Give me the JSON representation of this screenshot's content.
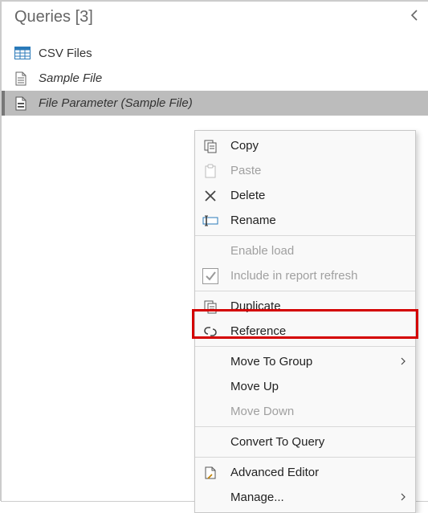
{
  "panel": {
    "title": "Queries [3]"
  },
  "queries": [
    {
      "label": "CSV Files"
    },
    {
      "label": "Sample File"
    },
    {
      "label": "File Parameter (Sample File)"
    }
  ],
  "menu": {
    "copy": "Copy",
    "paste": "Paste",
    "delete": "Delete",
    "rename": "Rename",
    "enable_load": "Enable load",
    "include_refresh": "Include in report refresh",
    "duplicate": "Duplicate",
    "reference": "Reference",
    "move_to_group": "Move To Group",
    "move_up": "Move Up",
    "move_down": "Move Down",
    "convert_to_query": "Convert To Query",
    "advanced_editor": "Advanced Editor",
    "manage": "Manage..."
  }
}
